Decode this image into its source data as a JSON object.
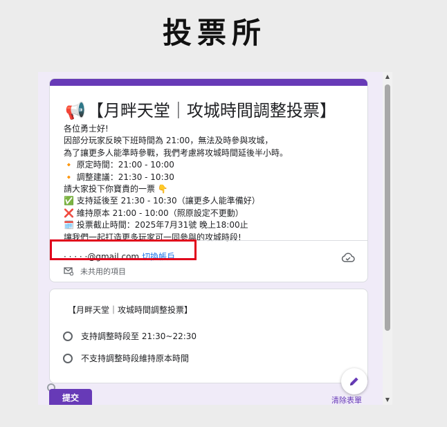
{
  "page": {
    "title": "投票所"
  },
  "form": {
    "title_icon": "📢",
    "title": "【月畔天堂｜攻城時間調整投票】",
    "description_lines": [
      "各位勇士好!",
      "因部分玩家反映下班時間為 21:00，無法及時參與攻城，",
      "為了讓更多人能準時參戰，我們考慮將攻城時間延後半小時。",
      "🔸 原定時間：21:00 - 10:00",
      "🔸 調整建議：21:30 - 10:30",
      "請大家投下你寶貴的一票 👇",
      "✅ 支持延後至 21:30 - 10:30（讓更多人能準備好）",
      "❌ 維持原本 21:00 - 10:00（照原設定不更動）",
      "🗓️ 投票截止時間：2025年7月31號 晚上18:00止",
      "讓我們一起打造更多玩家可一同參與的攻城時段!"
    ],
    "account": {
      "email": "· · ·  · ·@gmail.com",
      "switch_label": "切換帳戶"
    },
    "unshared_label": "未共用的項目",
    "accent_color": "#673ab7"
  },
  "question": {
    "title": "【月畔天堂｜攻城時間調整投票】",
    "options": [
      "支持調整時段至 21:30~22:30",
      "不支持調整時段維持原本時間"
    ]
  },
  "footer": {
    "submit_label": "提交",
    "clear_label": "清除表單"
  },
  "icons": {
    "cloud": "cloud-check-icon",
    "mail": "mail-lock-icon",
    "edit": "pencil-icon",
    "scroll_up": "triangle-up-icon",
    "scroll_down": "triangle-down-icon"
  },
  "annotation": {
    "highlight_color": "#e0001a"
  }
}
